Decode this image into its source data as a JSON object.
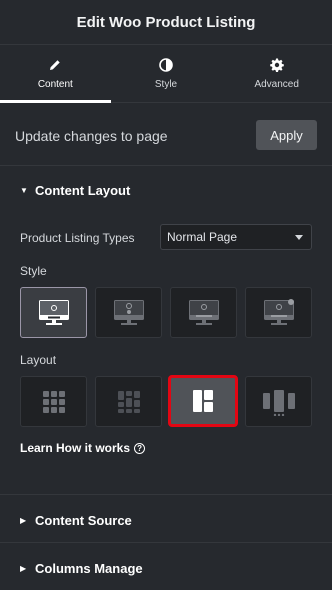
{
  "header": {
    "title": "Edit Woo Product Listing"
  },
  "tabs": [
    {
      "label": "Content",
      "icon": "pencil-icon",
      "active": true
    },
    {
      "label": "Style",
      "icon": "contrast-icon",
      "active": false
    },
    {
      "label": "Advanced",
      "icon": "gear-icon",
      "active": false
    }
  ],
  "update": {
    "text": "Update changes to page",
    "apply_label": "Apply"
  },
  "content_layout": {
    "title": "Content Layout",
    "listing_type_label": "Product Listing Types",
    "listing_type_value": "Normal Page",
    "style_label": "Style",
    "style_selected_index": 0,
    "layout_label": "Layout",
    "layout_selected_index": 2,
    "learn_label": "Learn How it works"
  },
  "sections": [
    {
      "title": "Content Source"
    },
    {
      "title": "Columns Manage"
    }
  ],
  "colors": {
    "bg": "#26292e",
    "accent_selected": "#e30613",
    "button": "#505358"
  }
}
